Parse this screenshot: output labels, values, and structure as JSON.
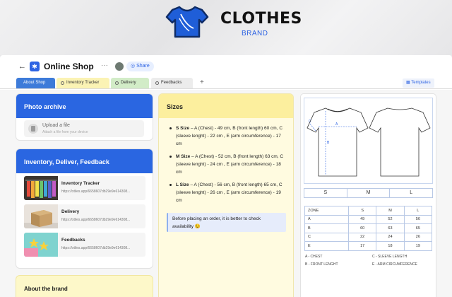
{
  "brand": {
    "title": "CLOTHES",
    "subtitle": "BRAND"
  },
  "header": {
    "back_icon": "←",
    "title": "Online Shop",
    "more_icon": "···",
    "share_label": "Share"
  },
  "tabs": [
    {
      "label": "About Shop",
      "color": "#3d7bd9"
    },
    {
      "label": "Inventory Tracker",
      "color": "#fbf3b4"
    },
    {
      "label": "Delivery",
      "color": "#d2ecc7"
    },
    {
      "label": "Feedbacks",
      "color": "#ececec"
    }
  ],
  "add_tab_label": "+",
  "templates_label": "Templates",
  "photo_archive": {
    "title": "Photo archive",
    "upload_label": "Upload a file",
    "upload_hint": "Attach a file from your device"
  },
  "inventory": {
    "title": "Inventory, Deliver, Feedback",
    "items": [
      {
        "name": "Inventory Tracker",
        "url": "https://xtiles.app/6658607db29e9e614308..."
      },
      {
        "name": "Delivery",
        "url": "https://xtiles.app/6658607db29e9e614308..."
      },
      {
        "name": "Feedbacks",
        "url": "https://xtiles.app/6658607db29e9e614308..."
      }
    ]
  },
  "about_brand": {
    "title": "About the brand"
  },
  "sizes": {
    "title": "Sizes",
    "items": [
      {
        "name": "S Size",
        "text": " – A (Chest) - 49 cm, B (front length) 60 cm, C (sleeve lenght) - 22 cm , E (arm circumference) - 17 cm"
      },
      {
        "name": "M Size",
        "text": " – A (Chest) - 52 cm, B (front length) 63 cm, C (sleeve lenght) - 24 cm , E (arm circumference) - 18 cm"
      },
      {
        "name": "L Size",
        "text": " – A (Chest) - 56 cm, B (front length) 65 cm, C (sleeve lenght) - 26 cm , E (arm circumference) - 19 cm"
      }
    ],
    "note": "Before placing an order, it is better to check availability 😉"
  },
  "size_chart": {
    "sml": [
      "S",
      "M",
      "L"
    ],
    "header": [
      "ZONE",
      "S",
      "M",
      "L"
    ],
    "rows": [
      [
        "A",
        "49",
        "52",
        "56"
      ],
      [
        "B",
        "60",
        "63",
        "65"
      ],
      [
        "C",
        "22",
        "24",
        "26"
      ],
      [
        "E",
        "17",
        "18",
        "19"
      ]
    ],
    "legend": {
      "a": "A - CHEST",
      "c": "C - SLEEVE LENGTH",
      "b": "B - FRONT LENGHT",
      "e": "E - ARM CIRCUMFERENCE"
    },
    "sketch_labels": {
      "a": "A",
      "b": "B",
      "c": "C"
    }
  }
}
